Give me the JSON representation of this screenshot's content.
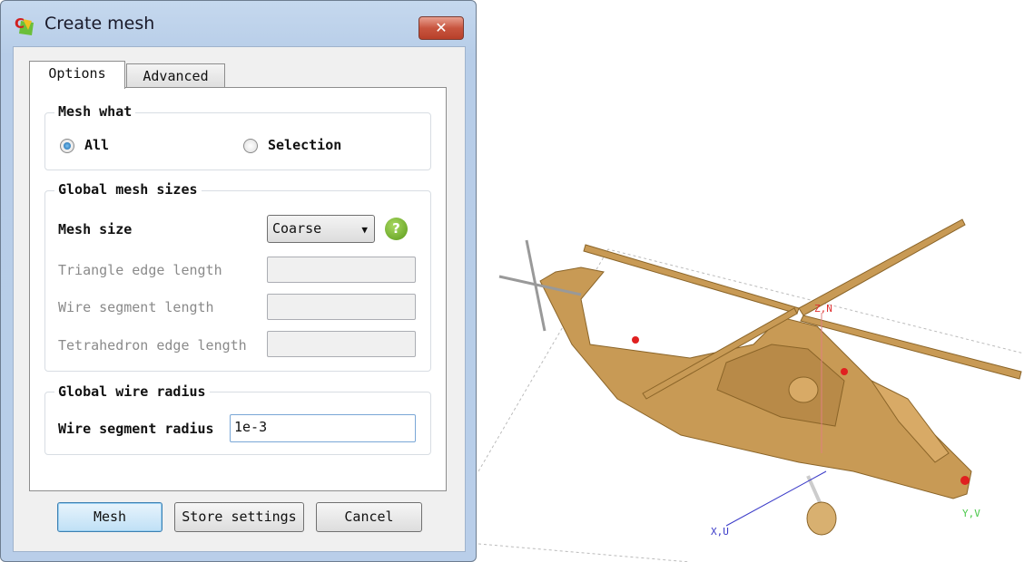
{
  "dialog": {
    "title": "Create mesh",
    "close_icon": "close-icon",
    "tabs": [
      {
        "label": "Options",
        "active": true
      },
      {
        "label": "Advanced",
        "active": false
      }
    ],
    "mesh_what": {
      "legend": "Mesh what",
      "options": [
        {
          "label": "All",
          "selected": true
        },
        {
          "label": "Selection",
          "selected": false
        }
      ]
    },
    "global_mesh_sizes": {
      "legend": "Global mesh sizes",
      "mesh_size_label": "Mesh size",
      "mesh_size_value": "Coarse",
      "help_label": "?",
      "triangle_edge_length_label": "Triangle edge length",
      "triangle_edge_length_value": "",
      "wire_segment_length_label": "Wire segment length",
      "wire_segment_length_value": "",
      "tetrahedron_edge_length_label": "Tetrahedron edge length",
      "tetrahedron_edge_length_value": ""
    },
    "global_wire_radius": {
      "legend": "Global wire radius",
      "wire_segment_radius_label": "Wire segment radius",
      "wire_segment_radius_value": "1e-3"
    },
    "buttons": {
      "mesh": "Mesh",
      "store": "Store settings",
      "cancel": "Cancel"
    }
  },
  "viewer": {
    "axes": {
      "x": "X,U",
      "y": "Y,V",
      "z": "Z,N"
    },
    "colors": {
      "model": "#c89a55",
      "axis_x": "#3a3ac8",
      "axis_y": "#4bc84b",
      "axis_z": "#e03030"
    }
  }
}
